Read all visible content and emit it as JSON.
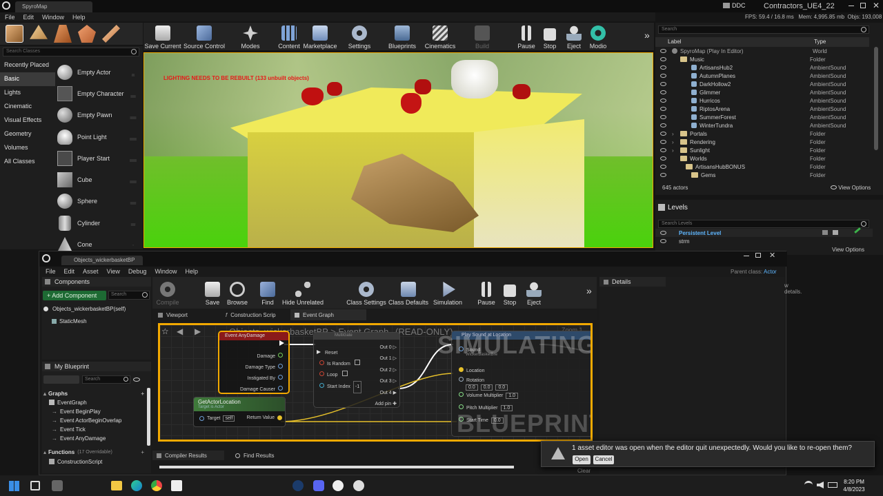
{
  "main_window": {
    "tab": "SpyroMap",
    "menu": [
      "File",
      "Edit",
      "Window",
      "Help"
    ],
    "ddc": "DDC",
    "project": "Contractors_UE4_22",
    "stats": "FPS: 59.4 / 16.8 ms   Mem: 4,995.85 mb  Objs: 193,008"
  },
  "toolbar": [
    "Save Current",
    "Source Control",
    "Modes",
    "Content",
    "Marketplace",
    "Settings",
    "Blueprints",
    "Cinematics",
    "Build",
    "Pause",
    "Stop",
    "Eject",
    "Modio"
  ],
  "place": {
    "search_placeholder": "Search Classes",
    "categories": [
      "Recently Placed",
      "Basic",
      "Lights",
      "Cinematic",
      "Visual Effects",
      "Geometry",
      "Volumes",
      "All Classes"
    ],
    "items": [
      "Empty Actor",
      "Empty Character",
      "Empty Pawn",
      "Point Light",
      "Player Start",
      "Cube",
      "Sphere",
      "Cylinder",
      "Cone"
    ]
  },
  "viewport": {
    "warning": "LIGHTING NEEDS TO BE REBUILT (133 unbuilt objects)"
  },
  "outliner": {
    "search_placeholder": "Search",
    "col_label": "Label",
    "col_type": "Type",
    "rows": [
      {
        "label": "SpyroMap (Play In Editor)",
        "type": "World"
      },
      {
        "label": "Music",
        "type": "Folder"
      },
      {
        "label": "ArtisansHub2",
        "type": "AmbientSound"
      },
      {
        "label": "AutumnPlanes",
        "type": "AmbientSound"
      },
      {
        "label": "DarkHollow2",
        "type": "AmbientSound"
      },
      {
        "label": "Glimmer",
        "type": "AmbientSound"
      },
      {
        "label": "Hurricos",
        "type": "AmbientSound"
      },
      {
        "label": "RiptosArena",
        "type": "AmbientSound"
      },
      {
        "label": "SummerForest",
        "type": "AmbientSound"
      },
      {
        "label": "WinterTundra",
        "type": "AmbientSound"
      },
      {
        "label": "Portals",
        "type": "Folder"
      },
      {
        "label": "Rendering",
        "type": "Folder"
      },
      {
        "label": "Sunlight",
        "type": "Folder"
      },
      {
        "label": "Worlds",
        "type": "Folder"
      },
      {
        "label": "ArtisansHubBONUS",
        "type": "Folder"
      },
      {
        "label": "Gems",
        "type": "Folder"
      }
    ],
    "actor_count": "645 actors",
    "view_options": "View Options"
  },
  "levels": {
    "title": "Levels",
    "search_placeholder": "Search Levels",
    "persistent": "Persistent Level",
    "second": "strm",
    "view_options": "View Options"
  },
  "bp_window": {
    "tab": "Objects_wickerbasketBP",
    "menu": [
      "File",
      "Edit",
      "Asset",
      "View",
      "Debug",
      "Window",
      "Help"
    ],
    "parent_class_label": "Parent class:",
    "parent_class": "Actor",
    "toolbar": [
      "Compile",
      "Save",
      "Browse",
      "Find",
      "Hide Unrelated",
      "Class Settings",
      "Class Defaults",
      "Simulation",
      "Pause",
      "Stop",
      "Eject"
    ],
    "components_title": "Components",
    "add_component": "+ Add Component",
    "search": "Search",
    "comp_root": "Objects_wickerbasketBP(self)",
    "comp_child": "StaticMesh",
    "my_blueprint": "My Blueprint",
    "graphs_label": "Graphs",
    "event_graph": "EventGraph",
    "events": [
      "Event BeginPlay",
      "Event ActorBeginOverlap",
      "Event Tick",
      "Event AnyDamage"
    ],
    "functions_label": "Functions",
    "functions_overridable": "(17 Overridable)",
    "construction_script": "ConstructionScript",
    "tabs": [
      "Viewport",
      "Construction Scrip",
      "Event Graph"
    ],
    "breadcrumb": "Objects_wickerbasketBP  >  Event Graph",
    "readonly": "(READ-ONLY)",
    "zoom": "Zoom 1",
    "simulating": "SIMULATING",
    "blueprint": "BLUEPRINT",
    "details_title": "Details",
    "details_hint": "w details.",
    "bottom_tabs": [
      "Compiler Results",
      "Find Results"
    ],
    "clear": "Clear"
  },
  "nodes": {
    "damage_title": "Event AnyDamage",
    "damage_pins": [
      "Damage",
      "Damage Type",
      "Instigated By",
      "Damage Causer"
    ],
    "multigate_title": "MultiGate",
    "multigate_in": [
      "Reset",
      "Is Random",
      "Loop",
      "Start Index"
    ],
    "multigate_start": "-1",
    "multigate_out": [
      "Out 0",
      "Out 1",
      "Out 2",
      "Out 3",
      "Out 4"
    ],
    "add_pin": "Add pin",
    "getloc_title": "GetActorLocation",
    "getloc_sub": "Target is Actor",
    "target": "Target",
    "self": "self",
    "return_value": "Return Value",
    "sound_title": "Play Sound at Location",
    "sound_pin": "Sound",
    "sound_val": "WickerBasketBre",
    "location": "Location",
    "rotation": "Rotation",
    "rot_vals": [
      "0.0",
      "0.0",
      "0.0"
    ],
    "vol_mult": "Volume Multiplier",
    "vol_val": "1.0",
    "pitch_mult": "Pitch Multiplier",
    "pitch_val": "1.0",
    "start_time": "Start Time",
    "start_val": "0.0"
  },
  "notification": {
    "message": "1 asset editor was open when the editor quit unexpectedly. Would you like to re-open them?",
    "open": "Open",
    "cancel": "Cancel"
  },
  "taskbar": {
    "time": "8:20 PM",
    "date": "4/8/2023"
  }
}
